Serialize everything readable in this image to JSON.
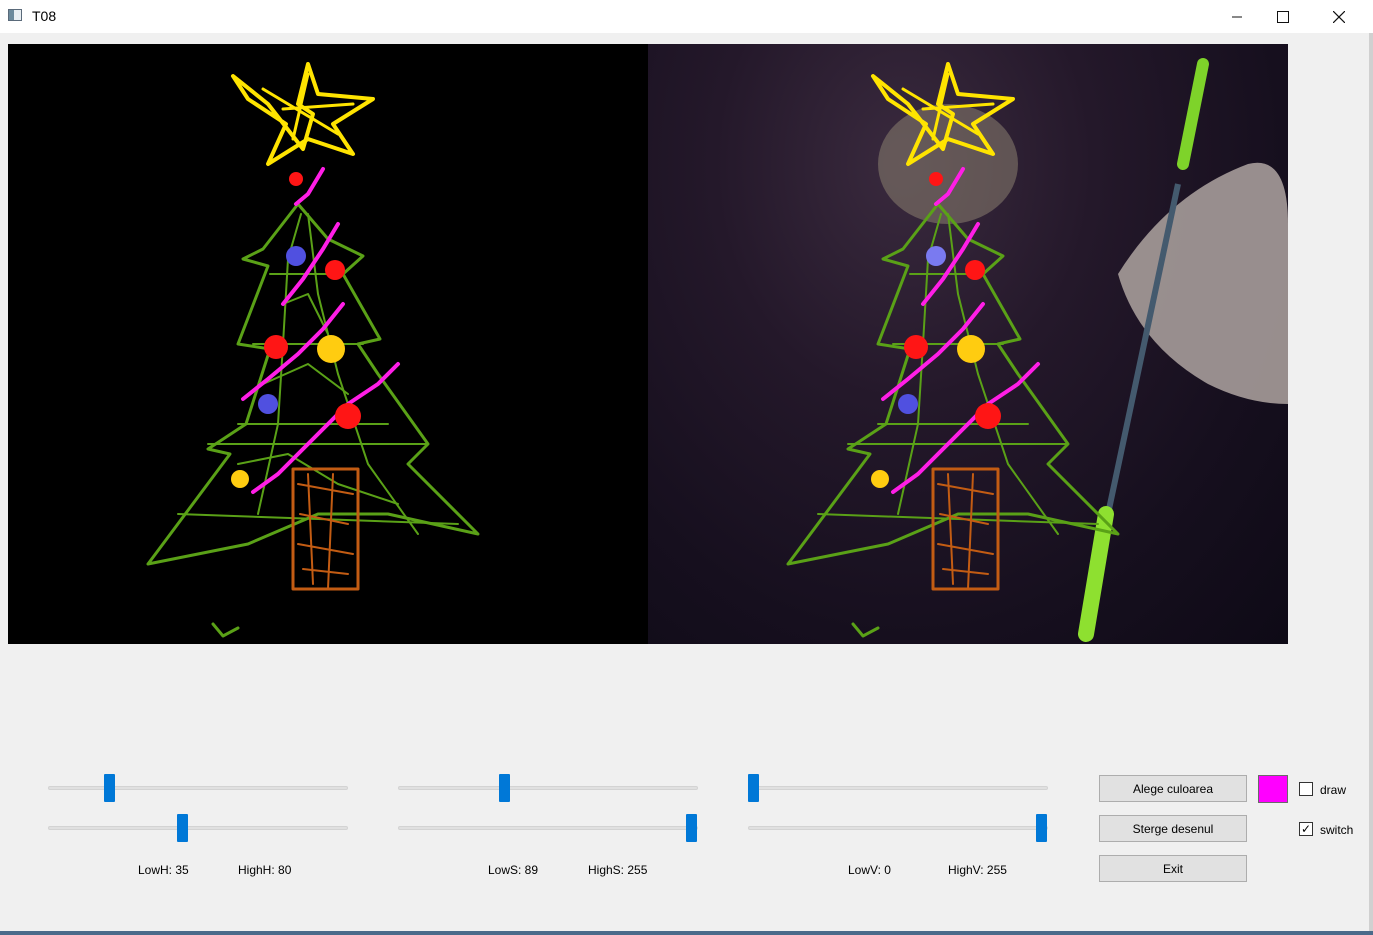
{
  "window": {
    "title": "T08",
    "icons": {
      "app": "app-window-icon",
      "minimize": "minimize-icon",
      "maximize": "maximize-icon",
      "close": "close-icon"
    }
  },
  "sliders": [
    {
      "name": "lowH-slider",
      "value": 35,
      "max": 179
    },
    {
      "name": "highH-slider",
      "value": 80,
      "max": 179
    },
    {
      "name": "lowS-slider",
      "value": 89,
      "max": 255
    },
    {
      "name": "highS-slider",
      "value": 255,
      "max": 255
    },
    {
      "name": "lowV-slider",
      "value": 0,
      "max": 255
    },
    {
      "name": "highV-slider",
      "value": 255,
      "max": 255
    }
  ],
  "labels": {
    "lowH": "LowH: 35",
    "highH": "HighH: 80",
    "lowS": "LowS: 89",
    "highS": "HighS: 255",
    "lowV": "LowV: 0",
    "highV": "HighV: 255"
  },
  "buttons": {
    "choose_color": "Alege culoarea",
    "clear": "Sterge desenul",
    "exit": "Exit"
  },
  "color": {
    "selected": "#ff00ff"
  },
  "checkboxes": {
    "draw": {
      "label": "draw",
      "checked": false
    },
    "switch": {
      "label": "switch",
      "checked": true
    }
  }
}
